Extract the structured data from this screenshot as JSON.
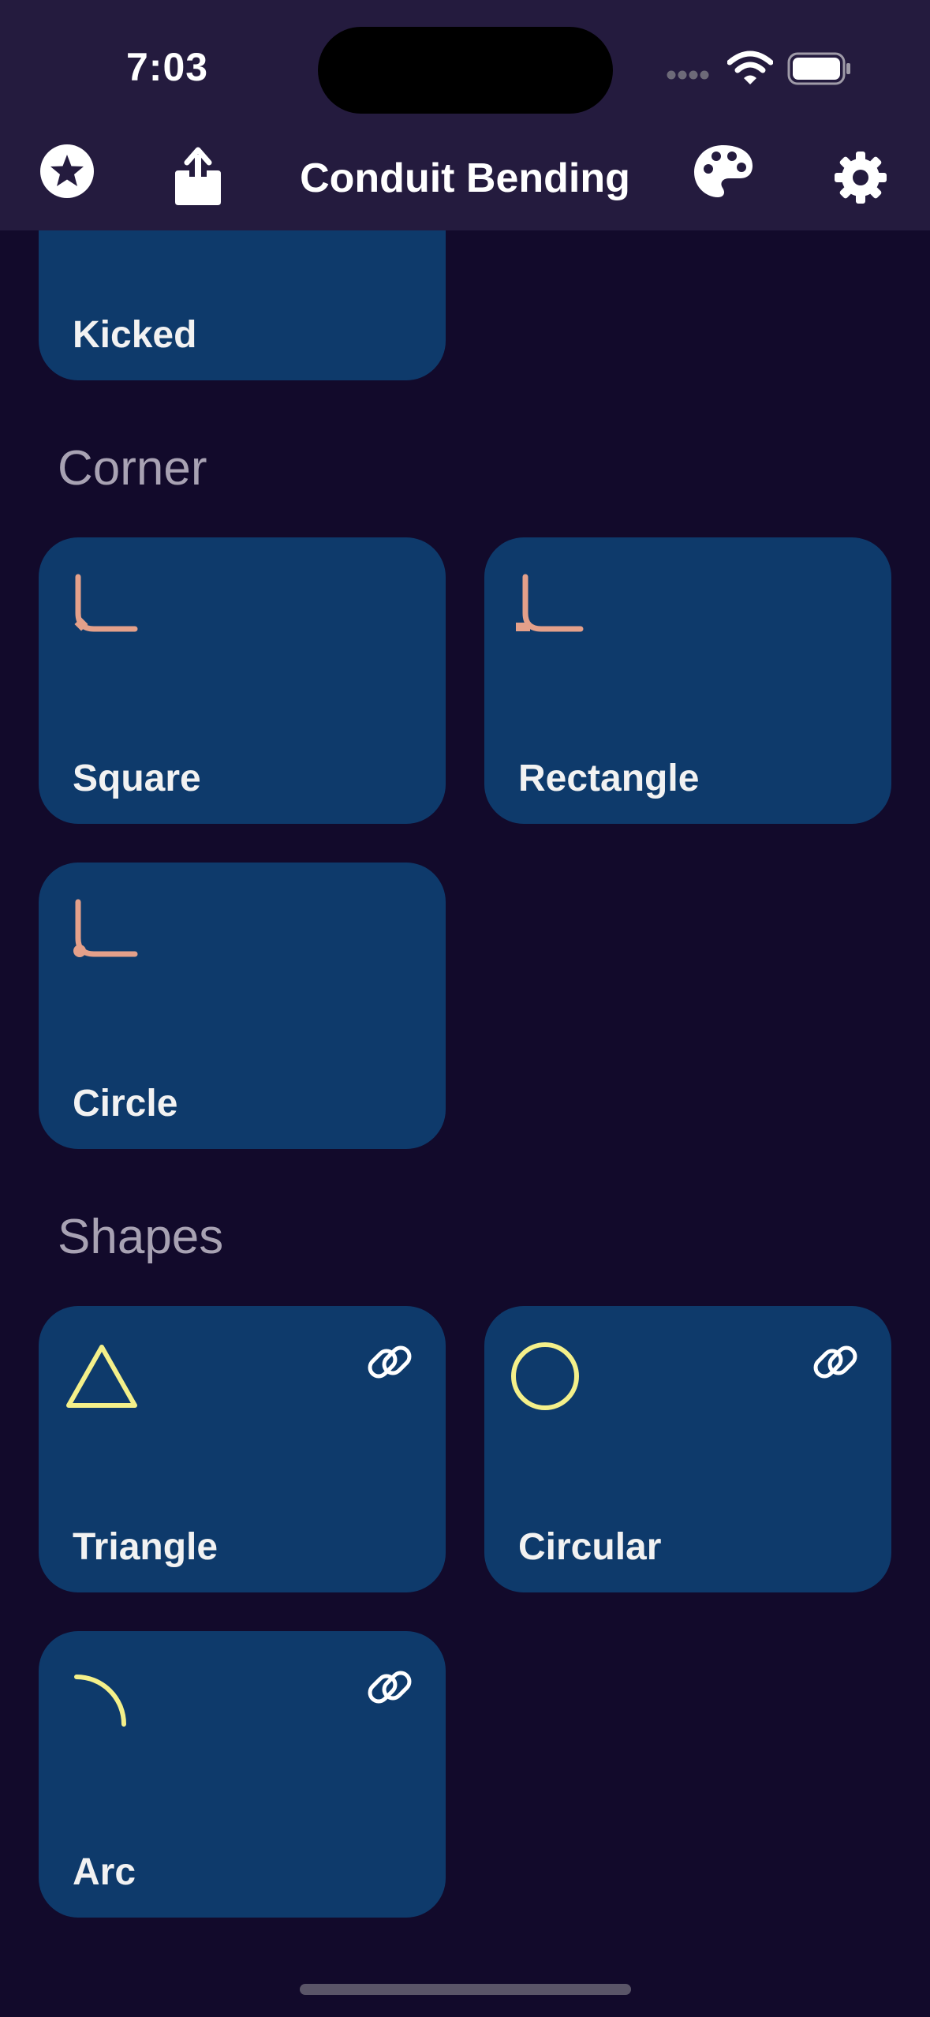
{
  "status_bar": {
    "time": "7:03"
  },
  "nav": {
    "title": "Conduit Bending"
  },
  "cards_top": [
    {
      "label": "Kicked"
    }
  ],
  "sections": [
    {
      "title": "Corner",
      "cards": [
        {
          "label": "Square"
        },
        {
          "label": "Rectangle"
        },
        {
          "label": "Circle"
        }
      ]
    },
    {
      "title": "Shapes",
      "cards": [
        {
          "label": "Triangle"
        },
        {
          "label": "Circular"
        },
        {
          "label": "Arc"
        }
      ]
    }
  ],
  "colors": {
    "background": "#120a2b",
    "card": "#0e3a6b",
    "corner_icon": "#e4a08a",
    "shape_icon": "#f4f08a"
  }
}
